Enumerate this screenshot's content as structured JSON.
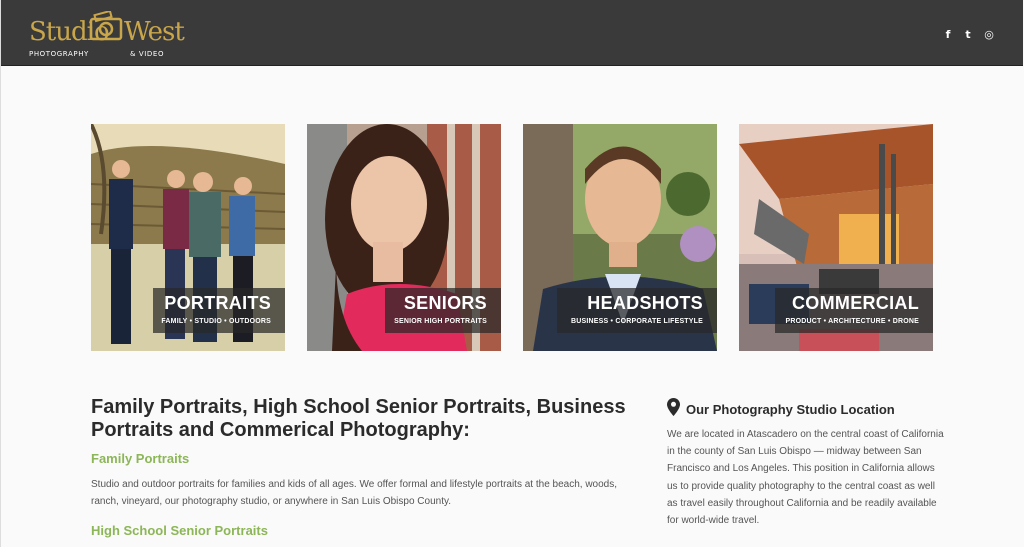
{
  "header": {
    "logo": {
      "word1": "Studio",
      "word2": "West",
      "sub_left": "PHOTOGRAPHY",
      "sub_right": "& VIDEO"
    },
    "social": [
      {
        "icon": "facebook-icon",
        "glyph": "f"
      },
      {
        "icon": "twitter-icon",
        "glyph": "t"
      },
      {
        "icon": "instagram-icon",
        "glyph": "◎"
      }
    ]
  },
  "tiles": [
    {
      "title": "PORTRAITS",
      "subtitle": "FAMILY • STUDIO • OUTDOORS"
    },
    {
      "title": "SENIORS",
      "subtitle": "SENIOR HIGH PORTRAITS"
    },
    {
      "title": "HEADSHOTS",
      "subtitle": "BUSINESS • CORPORATE LIFESTYLE"
    },
    {
      "title": "COMMERCIAL",
      "subtitle": "PRODUCT • ARCHITECTURE • DRONE"
    }
  ],
  "main": {
    "heading": "Family Portraits, High School Senior Portraits, Business Portraits and Commerical Photography:",
    "family_heading": "Family Portraits",
    "family_text": "Studio and outdoor portraits for families and kids of all ages. We offer formal and lifestyle portraits at the beach, woods, ranch, vineyard, our photography studio, or anywhere in San Luis Obispo County.",
    "senior_heading": "High School Senior Portraits"
  },
  "location": {
    "title": "Our Photography Studio Location",
    "text": "We are located in Atascadero on the central coast of California in the county of San Luis Obispo — midway between San Francisco and Los Angeles. This position in California allows us to provide quality photography to the central coast as well as travel easily throughout California and be readily available for world-wide travel."
  },
  "colors": {
    "header_bg": "#3a3a3a",
    "logo_gold": "#c9a64a",
    "accent_green": "#8cb657",
    "text_dark": "#2b2b2b"
  }
}
